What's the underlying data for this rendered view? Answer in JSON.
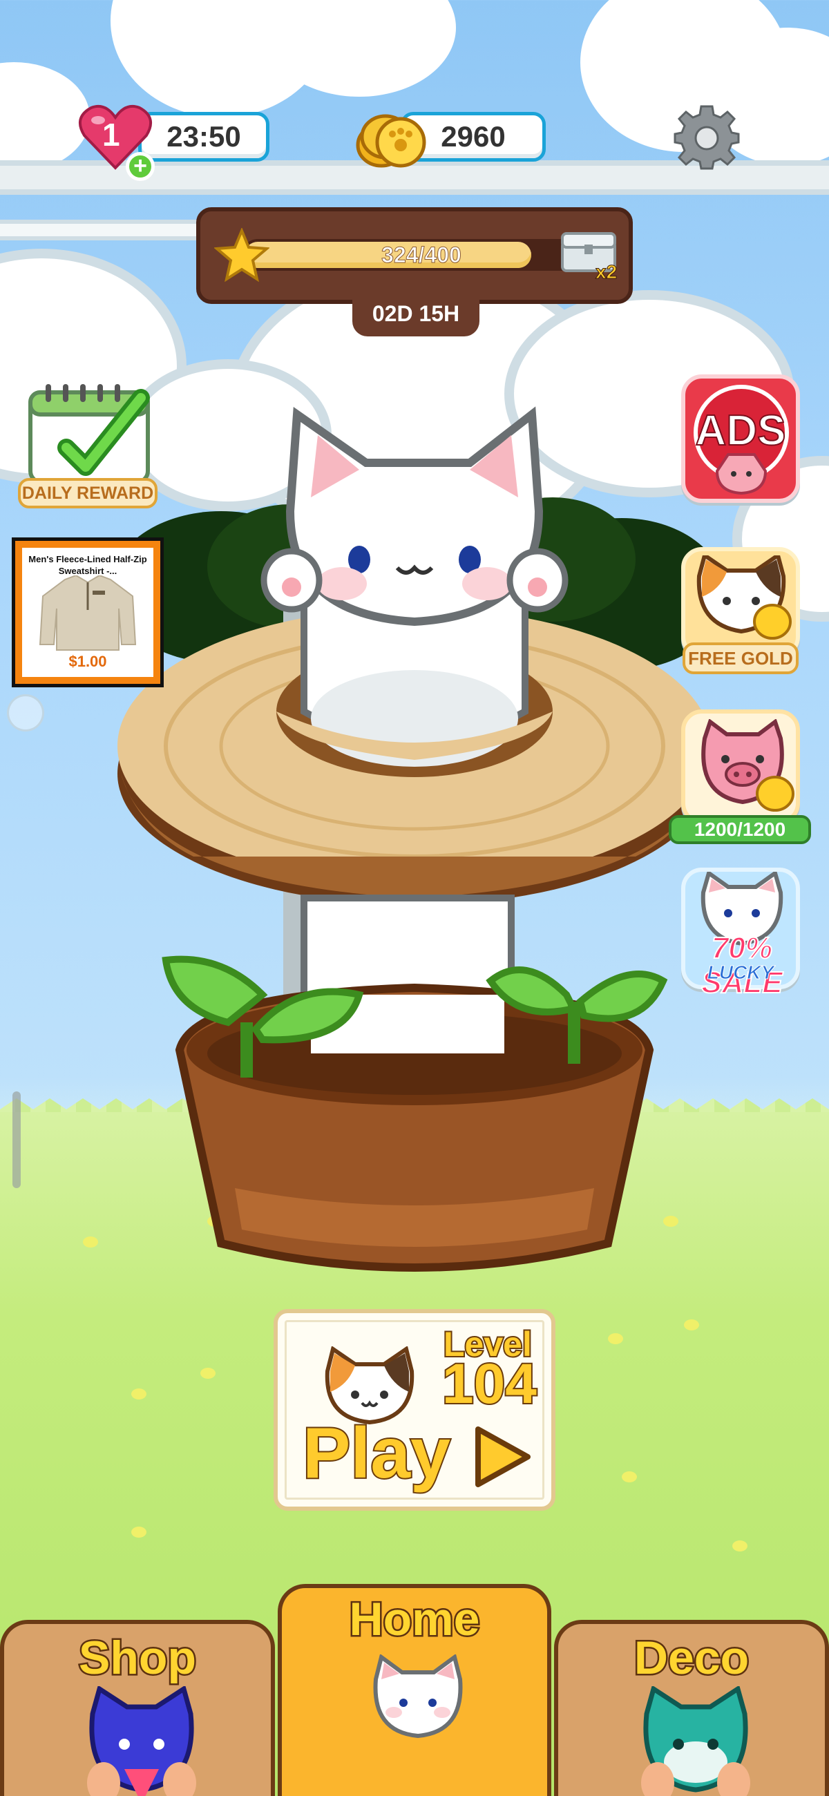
{
  "hud": {
    "lives": "1",
    "life_timer": "23:50",
    "coins": "2960",
    "icons": [
      "heart-icon",
      "add-lives-icon",
      "coin-stack-icon",
      "settings-gear-icon"
    ]
  },
  "event": {
    "progress_text": "324/400",
    "progress_fraction": 0.81,
    "reward_multiplier": "x2",
    "time_left": "02D 15H"
  },
  "left_side": {
    "daily_reward_label": "DAILY REWARD",
    "ad": {
      "title": "Men's Fleece-Lined Half-Zip Sweatshirt -...",
      "price": "$1.00"
    }
  },
  "right_side": {
    "ads_label": "ADS",
    "free_gold_label": "FREE GOLD",
    "piggy_bank_value": "1200/1200",
    "sale_label": "70% SALE",
    "sale_sublabel": "LUCKY"
  },
  "play_card": {
    "level_word": "Level",
    "level_number": "104",
    "play_label": "Play"
  },
  "bottom_nav": {
    "shop_label": "Shop",
    "home_label": "Home",
    "deco_label": "Deco"
  },
  "colors": {
    "sky": "#a9d6fb",
    "grass": "#c4ec7d",
    "brand_yellow": "#ffcb2d",
    "wood_dark": "#6b3b2a",
    "pill_border": "#1aa3d8"
  }
}
